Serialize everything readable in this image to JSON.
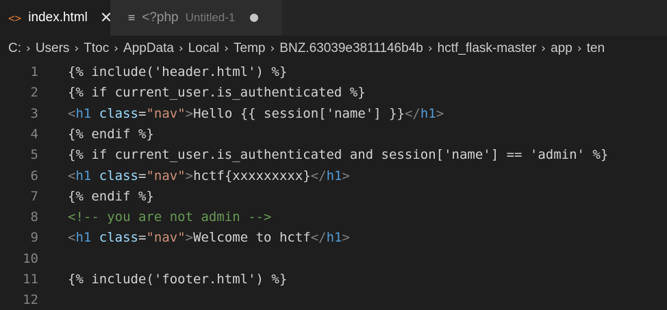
{
  "tabs": [
    {
      "icon": "<>",
      "label": "index.html",
      "close": "✕",
      "active": true
    },
    {
      "icon": "≡",
      "label": "<?php",
      "description": "Untitled-1",
      "active": false
    }
  ],
  "breadcrumb": [
    "C:",
    "Users",
    "Ttoc",
    "AppData",
    "Local",
    "Temp",
    "BNZ.63039e3811146b4b",
    "hctf_flask-master",
    "app",
    "ten"
  ],
  "lines": [
    {
      "n": "1",
      "tokens": [
        [
          "text",
          "{% include('header.html') %}"
        ]
      ]
    },
    {
      "n": "2",
      "tokens": [
        [
          "text",
          "{% if current_user.is_authenticated %}"
        ]
      ]
    },
    {
      "n": "3",
      "tokens": [
        [
          "tag",
          "<"
        ],
        [
          "name",
          "h1"
        ],
        [
          "text",
          " "
        ],
        [
          "attr",
          "class"
        ],
        [
          "text",
          "="
        ],
        [
          "str",
          "\"nav\""
        ],
        [
          "tag",
          ">"
        ],
        [
          "text",
          "Hello {{ session['name'] }}"
        ],
        [
          "tag",
          "</"
        ],
        [
          "name",
          "h1"
        ],
        [
          "tag",
          ">"
        ]
      ]
    },
    {
      "n": "4",
      "tokens": [
        [
          "text",
          "{% endif %}"
        ]
      ]
    },
    {
      "n": "5",
      "tokens": [
        [
          "text",
          "{% if current_user.is_authenticated and session['name'] == 'admin' %}"
        ]
      ]
    },
    {
      "n": "6",
      "tokens": [
        [
          "tag",
          "<"
        ],
        [
          "name",
          "h1"
        ],
        [
          "text",
          " "
        ],
        [
          "attr",
          "class"
        ],
        [
          "text",
          "="
        ],
        [
          "str",
          "\"nav\""
        ],
        [
          "tag",
          ">"
        ],
        [
          "text",
          "hctf{xxxxxxxxx}"
        ],
        [
          "tag",
          "</"
        ],
        [
          "name",
          "h1"
        ],
        [
          "tag",
          ">"
        ]
      ]
    },
    {
      "n": "7",
      "tokens": [
        [
          "text",
          "{% endif %}"
        ]
      ]
    },
    {
      "n": "8",
      "tokens": [
        [
          "com",
          "<!-- you are not admin -->"
        ]
      ]
    },
    {
      "n": "9",
      "tokens": [
        [
          "tag",
          "<"
        ],
        [
          "name",
          "h1"
        ],
        [
          "text",
          " "
        ],
        [
          "attr",
          "class"
        ],
        [
          "text",
          "="
        ],
        [
          "str",
          "\"nav\""
        ],
        [
          "tag",
          ">"
        ],
        [
          "text",
          "Welcome to hctf"
        ],
        [
          "tag",
          "</"
        ],
        [
          "name",
          "h1"
        ],
        [
          "tag",
          ">"
        ]
      ]
    },
    {
      "n": "10",
      "tokens": []
    },
    {
      "n": "11",
      "tokens": [
        [
          "text",
          "{% include('footer.html') %}"
        ]
      ]
    },
    {
      "n": "12",
      "tokens": []
    }
  ],
  "colors": {
    "background": "#1e1e1e",
    "tag_bracket": "#808080",
    "tag_name": "#569cd6",
    "attribute": "#9cdcfe",
    "string": "#ce9178",
    "comment": "#6a9955",
    "text": "#d4d4d4",
    "html_icon": "#e37933"
  }
}
